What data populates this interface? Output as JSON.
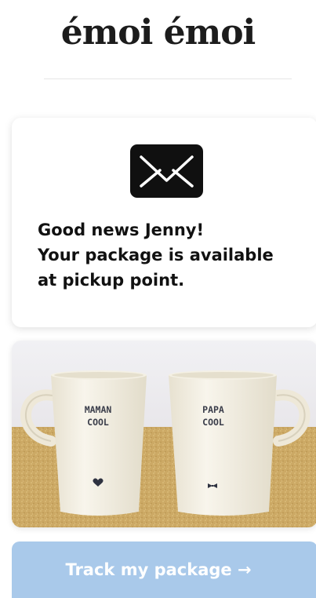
{
  "brand": {
    "logo_text": "émoi émoi"
  },
  "notification": {
    "icon": "envelope-icon",
    "line1": "Good news Jenny!",
    "line2": "Your package is available",
    "line3": "at pickup point."
  },
  "product": {
    "left_mug_text_line1": "MAMAN",
    "left_mug_text_line2": "COOL",
    "right_mug_text_line1": "PAPA",
    "right_mug_text_line2": "COOL"
  },
  "cta": {
    "label": "Track my package →"
  },
  "colors": {
    "button_bg": "#a9c9ea",
    "text_dark": "#111111",
    "icon_bg": "#101010"
  }
}
